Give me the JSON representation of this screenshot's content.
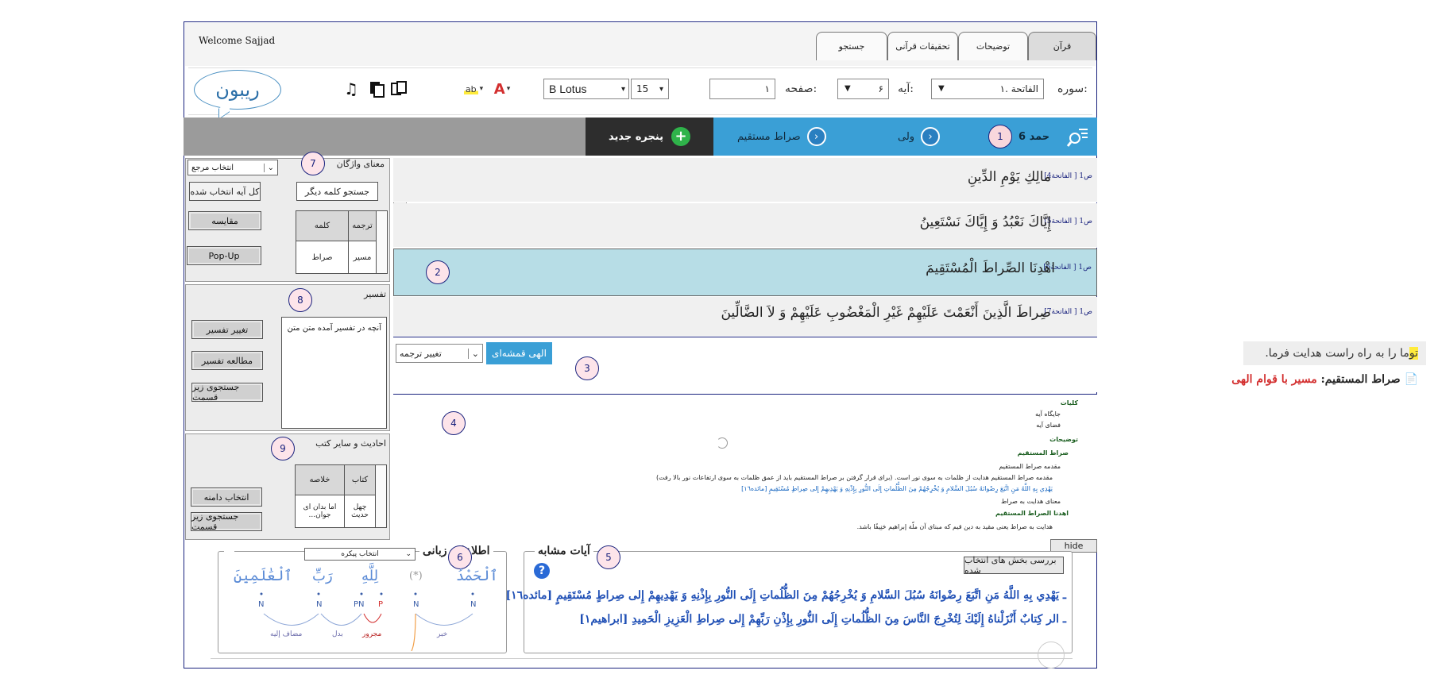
{
  "header": {
    "welcome": "Welcome Sajjad",
    "tabs": [
      "قرآن",
      "توضیحات",
      "تحقیقات قرآنی",
      "جستجو"
    ]
  },
  "toolbar": {
    "logo_text": "ریبون",
    "sura_label": "سوره:",
    "sura_value": "۱. الفاتحة",
    "aye_label": "آیه:",
    "aye_value": "۶",
    "page_label": "صفحه:",
    "page_value": "۱",
    "font_name": "B Lotus",
    "font_size": "15",
    "icons": [
      "music-icon",
      "copy-icon",
      "paste-icon",
      "highlight-icon",
      "font-color-icon"
    ]
  },
  "ribbon": {
    "item1_label": "حمد 6",
    "item1_badge": "1",
    "item2_label": "ولی",
    "item3_label": "صراط مستقیم",
    "new_window_label": "پنجره جدید"
  },
  "verses": [
    {
      "ref": "[الفاتحة4 ] ص1",
      "text": "مالِكِ يَوْمِ الدِّينِ"
    },
    {
      "ref": "[الفاتحة5 ] ص1",
      "text": "إِيَّاكَ نَعْبُدُ وَ إِيَّاكَ نَسْتَعِينُ"
    },
    {
      "ref": "[الفاتحة6 ] ص1",
      "text": "اهْدِنَا الصِّراطَ الْمُسْتَقِيمَ"
    },
    {
      "ref": "[الفاتحة7 ] ص1",
      "text": "صِراطَ الَّذِينَ أَنْعَمْتَ عَلَيْهِمْ غَيْرِ الْمَغْضُوبِ عَلَيْهِمْ وَ لاَ الضَّالِّينَ"
    }
  ],
  "hide_label": "hide",
  "translation": {
    "highlight": "تو",
    "text": "ما را به راه راست هدایت فرما.",
    "translator": "الهی قمشه‌ای",
    "change_label": "تغییر ترجمه",
    "title_black": "صراط المستقیم:",
    "title_red": "مسیر با قوام الهی"
  },
  "tree": [
    {
      "t": "کلیات",
      "cls": "g"
    },
    {
      "t": "جایگاه آیه",
      "cls": ""
    },
    {
      "t": "فضای آیه",
      "cls": ""
    },
    {
      "t": "توضیحات",
      "cls": "g"
    },
    {
      "t": "صراط المستقیم",
      "cls": "g"
    },
    {
      "t": "مقدمه صراط المستقیم",
      "cls": ""
    },
    {
      "t": "مقدمه صراط المستقیم هدایت از ظلمات به سوی نور است. (برای قرار گرفتن بر صراط المستقیم باید از عمق ظلمات به سوی ارتفاعات نور بالا رفت)",
      "cls": ""
    },
    {
      "t": "يَهْدِي بِهِ اللَّهُ مَنِ اتَّبَعَ رِضْوانَهُ سُبُلَ السَّلامِ وَ يُخْرِجُهُمْ مِنَ الظُّلُماتِ إِلَى النُّورِ بِإِذْنِهِ وَ يَهْدِيهِمْ إِلى صِراطٍ مُسْتَقِيمٍ [مائده١٦]",
      "cls": "b"
    },
    {
      "t": "معنای هدایت به صراط",
      "cls": ""
    },
    {
      "t": "اهدنا الصراط المستقیم",
      "cls": "g"
    },
    {
      "t": "هدایت به صراط یعنی مقید به دین قیم که مبنای آن ملّة إبراهيم حَنِيفًا باشد.",
      "cls": ""
    }
  ],
  "panels": {
    "words": {
      "title": "معنای واژگان",
      "badge": "7",
      "ref_select": "انتخاب مرجع",
      "search_other": "جستجو کلمه دیگر",
      "whole_aye": "کل آیه انتخاب شده",
      "compare": "مقایسه",
      "popup": "Pop-Up",
      "col_translation": "ترجمه",
      "col_word": "کلمه",
      "cell_translation": "مسیر",
      "cell_word": "صراط"
    },
    "tafsir": {
      "title": "تفسیر",
      "badge": "8",
      "content": "آنچه در تفسیر آمده متن متن",
      "change": "تغییر تفسیر",
      "study": "مطالعه تفسیر",
      "search_sub": "جستجوی زیر قسمت"
    },
    "hadith": {
      "title": "احادیث و سایر کتب",
      "badge": "9",
      "col_book": "کتاب",
      "col_summary": "خلاصه",
      "cell_book": "چهل حدیث",
      "cell_summary": "اما بدان ای جوان...",
      "select_scope": "انتخاب دامنه",
      "search_sub": "جستجوی زیر قسمت"
    }
  },
  "markers": [
    "2",
    "3",
    "4",
    "5",
    "6"
  ],
  "similar": {
    "title": "آیات مشابه",
    "review_label": "بررسی بخش های انتخاب شده",
    "lines": [
      "ـ يَهْدِي بِهِ اللَّهُ مَنِ اتَّبَعَ رِضْوانَهُ سُبُلَ السَّلامِ وَ يُخْرِجُهُمْ مِنَ الظُّلُماتِ إِلَى النُّورِ بِإِذْنِهِ وَ يَهْدِيهِمْ إِلى صِراطٍ مُسْتَقِيمٍ [مائده١٦]",
      "ـ الر كِتابٌ أَنْزَلْناهُ إِلَيْكَ لِتُخْرِجَ النَّاسَ مِنَ الظُّلُماتِ إِلَى النُّورِ بِإِذْنِ رَبِّهِمْ إِلى صِراطِ الْعَزِيزِ الْحَمِيدِ [ابراهیم١]"
    ]
  },
  "grammar": {
    "title": "اطلاعات زبانی",
    "corpus_select": "انتخاب پیکره",
    "words": [
      "ٱلْحَمْدُ",
      "(*)",
      "لِلَّهِ",
      "رَبِّ",
      "ٱلْعَٰلَمِينَ"
    ],
    "tags": [
      "N",
      "N",
      "P",
      "PN",
      "N",
      "N"
    ],
    "roles": [
      "خبر",
      "مجرور",
      "بدل",
      "مضاف إليه"
    ]
  }
}
